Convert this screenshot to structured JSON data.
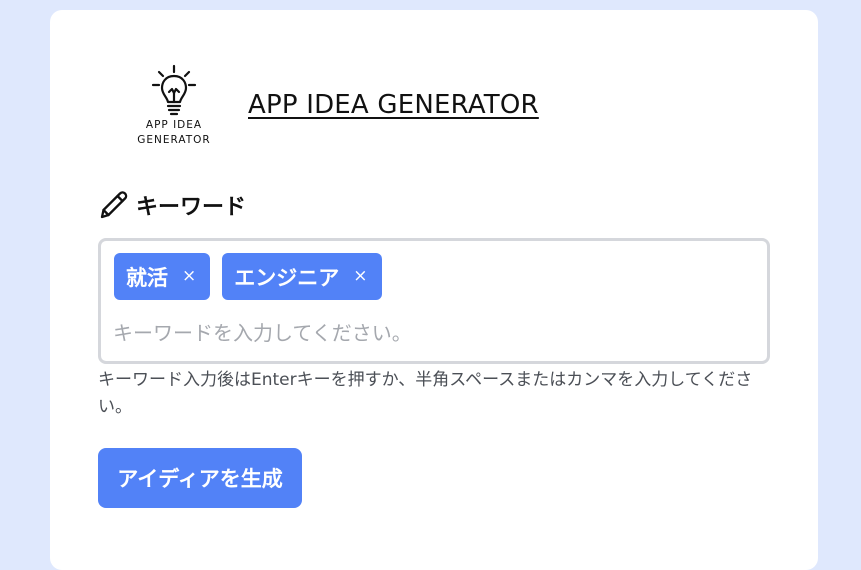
{
  "header": {
    "logo_text_line1": "APP IDEA",
    "logo_text_line2": "GENERATOR",
    "title": "APP IDEA GENERATOR"
  },
  "keywords": {
    "heading": "キーワード",
    "heading_icon": "pencil-icon",
    "chips": [
      {
        "label": "就活",
        "remove": "×"
      },
      {
        "label": "エンジニア",
        "remove": "×"
      }
    ],
    "placeholder": "キーワードを入力してください。",
    "value": "",
    "help": "キーワード入力後はEnterキーを押すか、半角スペースまたはカンマを入力してください。"
  },
  "actions": {
    "generate_label": "アイディアを生成"
  },
  "colors": {
    "background": "#dfe8fd",
    "accent": "#5282f7",
    "border": "#d5d7dc"
  }
}
